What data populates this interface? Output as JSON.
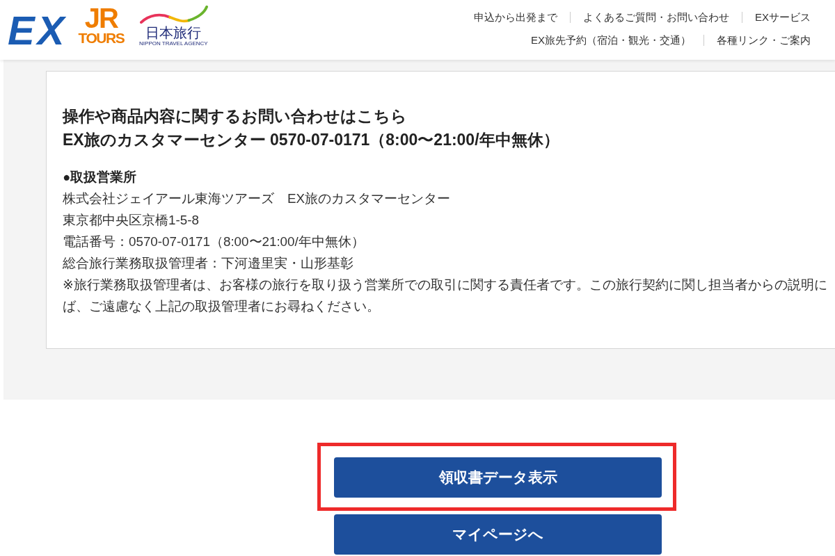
{
  "header": {
    "logos": [
      {
        "kind": "ex",
        "text": "EX"
      },
      {
        "kind": "jr_tours",
        "mark": "JR",
        "text": "TOURS"
      },
      {
        "kind": "nippon_travel",
        "text": "日本旅行",
        "subtext": "NIPPON TRAVEL AGENCY"
      }
    ],
    "nav_rows": [
      {
        "links": [
          "申込から出発まで",
          "よくあるご質問・お問い合わせ",
          "EXサービス"
        ]
      },
      {
        "links": [
          "EX旅先予約（宿泊・観光・交通）",
          "各種リンク・ご案内"
        ]
      }
    ]
  },
  "contact": {
    "title": "操作や商品内容に関するお問い合わせはこちら",
    "phone_line": "EX旅のカスタマーセンター 0570-07-0171（8:00〜21:00/年中無休）",
    "office": {
      "heading": "●取扱営業所",
      "lines": [
        "株式会社ジェイアール東海ツアーズ　EX旅のカスタマーセンター",
        "東京都中央区京橋1-5-8",
        "電話番号：0570-07-0171（8:00〜21:00/年中無休）",
        "総合旅行業務取扱管理者：下河邉里実・山形基彰"
      ],
      "note_lines": [
        "※旅行業務取扱管理者は、お客様の旅行を取り扱う営業所での取引に関する責任者です。この旅行契約に関し担当者からの説明に",
        "ば、ご遠慮なく上記の取扱管理者にお尋ねください。"
      ]
    }
  },
  "buttons": [
    {
      "label": "領収書データ表示",
      "highlighted": true
    },
    {
      "label": "マイページへ",
      "highlighted": false
    }
  ]
}
